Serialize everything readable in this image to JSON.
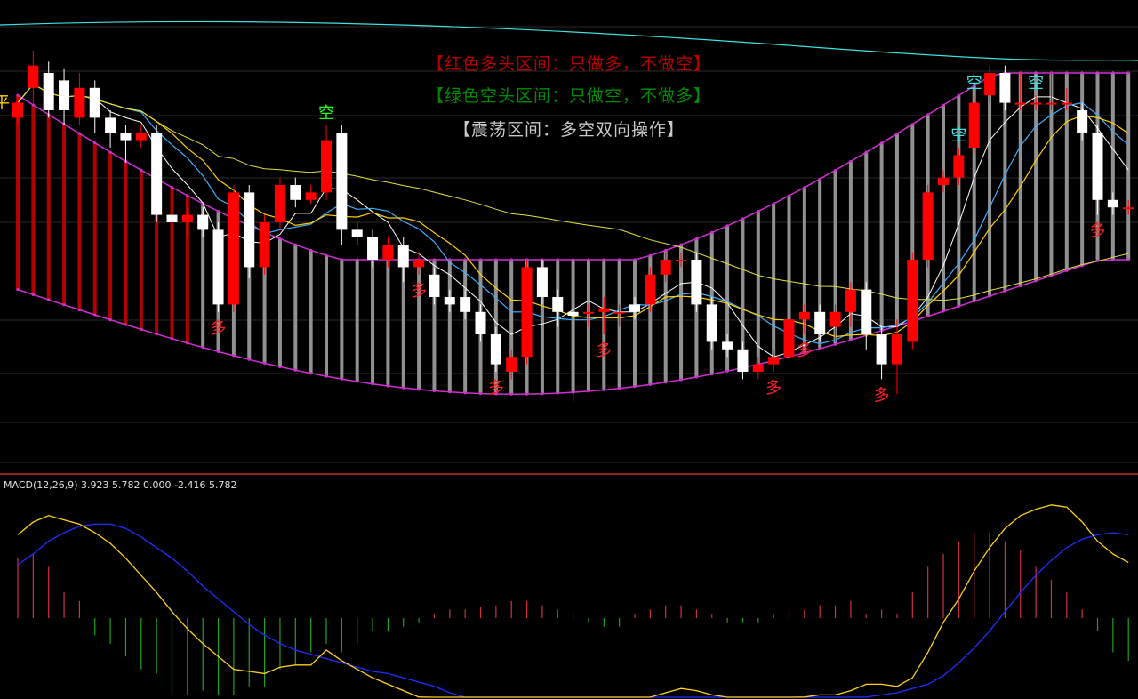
{
  "legend": {
    "red": "【红色多头区间：只做多，不做空】",
    "green": "【绿色空头区间：只做空，不做多】",
    "gray": "【震荡区间：多空双向操作】"
  },
  "macd_label": "MACD(12,26,9) 3.923 5.782 0.000 -2.416 5.782",
  "colors": {
    "bg": "#000000",
    "up": "#ff0000",
    "down": "#ffffff",
    "band": "#d030d0",
    "band_mid": "#e0e040",
    "ma_short": "#ffffff",
    "ma_blue": "#40b0ff",
    "ma_yellow": "#ffd000",
    "top_line": "#40e0e0",
    "bar_red": "#b00000",
    "bar_gray": "#909090",
    "signal_buy": "#ff2020",
    "signal_sell_cyan": "#40e0e0",
    "signal_sell_green": "#20ff20",
    "macd_pos": "#d03040",
    "macd_neg": "#20a020"
  },
  "chart_data": {
    "type": "candlestick",
    "price_ylim": [
      0,
      100
    ],
    "candles": [
      {
        "o": 78,
        "c": 82,
        "h": 84,
        "l": 76
      },
      {
        "o": 86,
        "c": 92,
        "h": 96,
        "l": 82
      },
      {
        "o": 90,
        "c": 80,
        "h": 93,
        "l": 78
      },
      {
        "o": 88,
        "c": 80,
        "h": 91,
        "l": 76
      },
      {
        "o": 78,
        "c": 86,
        "h": 90,
        "l": 76
      },
      {
        "o": 86,
        "c": 78,
        "h": 88,
        "l": 74
      },
      {
        "o": 78,
        "c": 74,
        "h": 80,
        "l": 70
      },
      {
        "o": 74,
        "c": 72,
        "h": 76,
        "l": 66
      },
      {
        "o": 72,
        "c": 74,
        "h": 76,
        "l": 70
      },
      {
        "o": 74,
        "c": 52,
        "h": 76,
        "l": 50
      },
      {
        "o": 52,
        "c": 50,
        "h": 54,
        "l": 48
      },
      {
        "o": 50,
        "c": 52,
        "h": 54,
        "l": 46
      },
      {
        "o": 52,
        "c": 48,
        "h": 54,
        "l": 46
      },
      {
        "o": 48,
        "c": 28,
        "h": 50,
        "l": 26
      },
      {
        "o": 28,
        "c": 58,
        "h": 60,
        "l": 26
      },
      {
        "o": 58,
        "c": 38,
        "h": 60,
        "l": 35
      },
      {
        "o": 38,
        "c": 50,
        "h": 52,
        "l": 36
      },
      {
        "o": 50,
        "c": 60,
        "h": 62,
        "l": 48
      },
      {
        "o": 60,
        "c": 56,
        "h": 62,
        "l": 54
      },
      {
        "o": 56,
        "c": 58,
        "h": 60,
        "l": 55
      },
      {
        "o": 58,
        "c": 72,
        "h": 76,
        "l": 56
      },
      {
        "o": 74,
        "c": 48,
        "h": 76,
        "l": 44
      },
      {
        "o": 48,
        "c": 46,
        "h": 50,
        "l": 44
      },
      {
        "o": 46,
        "c": 40,
        "h": 48,
        "l": 38
      },
      {
        "o": 40,
        "c": 44,
        "h": 46,
        "l": 38
      },
      {
        "o": 44,
        "c": 38,
        "h": 46,
        "l": 34
      },
      {
        "o": 38,
        "c": 40,
        "h": 42,
        "l": 36
      },
      {
        "o": 36,
        "c": 30,
        "h": 38,
        "l": 28
      },
      {
        "o": 30,
        "c": 28,
        "h": 32,
        "l": 26
      },
      {
        "o": 30,
        "c": 26,
        "h": 32,
        "l": 24
      },
      {
        "o": 26,
        "c": 20,
        "h": 28,
        "l": 18
      },
      {
        "o": 20,
        "c": 12,
        "h": 22,
        "l": 10
      },
      {
        "o": 10,
        "c": 14,
        "h": 16,
        "l": 8
      },
      {
        "o": 14,
        "c": 38,
        "h": 40,
        "l": 12
      },
      {
        "o": 38,
        "c": 30,
        "h": 40,
        "l": 28
      },
      {
        "o": 30,
        "c": 26,
        "h": 32,
        "l": 22
      },
      {
        "o": 26,
        "c": 25,
        "h": 28,
        "l": 2
      },
      {
        "o": 26,
        "c": 26,
        "h": 28,
        "l": 22
      },
      {
        "o": 26,
        "c": 27,
        "h": 30,
        "l": 20
      },
      {
        "o": 26,
        "c": 26,
        "h": 28,
        "l": 22
      },
      {
        "o": 28,
        "c": 26,
        "h": 30,
        "l": 24
      },
      {
        "o": 28,
        "c": 36,
        "h": 38,
        "l": 26
      },
      {
        "o": 36,
        "c": 40,
        "h": 42,
        "l": 34
      },
      {
        "o": 40,
        "c": 40,
        "h": 42,
        "l": 38
      },
      {
        "o": 40,
        "c": 28,
        "h": 42,
        "l": 26
      },
      {
        "o": 28,
        "c": 18,
        "h": 30,
        "l": 16
      },
      {
        "o": 18,
        "c": 16,
        "h": 20,
        "l": 14
      },
      {
        "o": 16,
        "c": 10,
        "h": 18,
        "l": 8
      },
      {
        "o": 10,
        "c": 12,
        "h": 14,
        "l": 8
      },
      {
        "o": 12,
        "c": 14,
        "h": 16,
        "l": 10
      },
      {
        "o": 14,
        "c": 24,
        "h": 26,
        "l": 12
      },
      {
        "o": 24,
        "c": 26,
        "h": 28,
        "l": 20
      },
      {
        "o": 26,
        "c": 20,
        "h": 28,
        "l": 18
      },
      {
        "o": 22,
        "c": 26,
        "h": 28,
        "l": 18
      },
      {
        "o": 26,
        "c": 32,
        "h": 34,
        "l": 22
      },
      {
        "o": 32,
        "c": 20,
        "h": 34,
        "l": 16
      },
      {
        "o": 20,
        "c": 12,
        "h": 22,
        "l": 8
      },
      {
        "o": 12,
        "c": 20,
        "h": 24,
        "l": 4
      },
      {
        "o": 18,
        "c": 40,
        "h": 42,
        "l": 16
      },
      {
        "o": 40,
        "c": 58,
        "h": 60,
        "l": 38
      },
      {
        "o": 60,
        "c": 62,
        "h": 64,
        "l": 58
      },
      {
        "o": 62,
        "c": 68,
        "h": 70,
        "l": 60
      },
      {
        "o": 70,
        "c": 82,
        "h": 84,
        "l": 68
      },
      {
        "o": 84,
        "c": 90,
        "h": 92,
        "l": 82
      },
      {
        "o": 90,
        "c": 82,
        "h": 92,
        "l": 80
      },
      {
        "o": 82,
        "c": 82,
        "h": 90,
        "l": 80
      },
      {
        "o": 82,
        "c": 82,
        "h": 84,
        "l": 80
      },
      {
        "o": 82,
        "c": 82,
        "h": 90,
        "l": 80
      },
      {
        "o": 82,
        "c": 82,
        "h": 86,
        "l": 80
      },
      {
        "o": 80,
        "c": 74,
        "h": 82,
        "l": 72
      },
      {
        "o": 74,
        "c": 56,
        "h": 76,
        "l": 52
      },
      {
        "o": 56,
        "c": 54,
        "h": 58,
        "l": 52
      },
      {
        "o": 54,
        "c": 54,
        "h": 56,
        "l": 52
      }
    ],
    "signals": [
      {
        "i": 0,
        "label": "平",
        "pos": "left"
      },
      {
        "i": 13,
        "label": "多",
        "pos": "below"
      },
      {
        "i": 20,
        "label": "空",
        "pos": "above"
      },
      {
        "i": 26,
        "label": "多",
        "pos": "below"
      },
      {
        "i": 31,
        "label": "多",
        "pos": "below"
      },
      {
        "i": 38,
        "label": "多",
        "pos": "below"
      },
      {
        "i": 49,
        "label": "多",
        "pos": "below"
      },
      {
        "i": 51,
        "label": "多",
        "pos": "below"
      },
      {
        "i": 56,
        "label": "多",
        "pos": "below"
      },
      {
        "i": 61,
        "label": "空",
        "pos": "above"
      },
      {
        "i": 62,
        "label": "空",
        "pos": "above"
      },
      {
        "i": 66,
        "label": "空",
        "pos": "above"
      },
      {
        "i": 70,
        "label": "多",
        "pos": "below"
      }
    ],
    "macd": {
      "params": "12,26,9",
      "dif": [
        3.9,
        4.5,
        4.8,
        4.6,
        4.4,
        4.0,
        3.5,
        2.8,
        2.0,
        1.2,
        0.3,
        -0.5,
        -1.2,
        -1.8,
        -2.4,
        -2.5,
        -2.6,
        -2.3,
        -2.2,
        -2.2,
        -1.5,
        -2.0,
        -2.4,
        -2.8,
        -3.1,
        -3.4,
        -3.7,
        -4.0,
        -4.3,
        -4.6,
        -4.9,
        -5.1,
        -5.3,
        -4.9,
        -4.6,
        -4.5,
        -4.5,
        -4.4,
        -4.3,
        -4.2,
        -4.1,
        -3.8,
        -3.5,
        -3.3,
        -3.4,
        -3.6,
        -3.9,
        -4.0,
        -4.1,
        -4.0,
        -3.8,
        -3.7,
        -3.6,
        -3.6,
        -3.4,
        -3.1,
        -3.1,
        -3.2,
        -2.8,
        -1.6,
        -0.2,
        0.9,
        2.2,
        3.3,
        4.2,
        4.8,
        5.1,
        5.3,
        5.2,
        4.5,
        3.6,
        3.0,
        2.6
      ],
      "dea": [
        2.5,
        3.0,
        3.6,
        4.0,
        4.3,
        4.4,
        4.4,
        4.2,
        3.8,
        3.3,
        2.8,
        2.2,
        1.5,
        0.9,
        0.3,
        -0.3,
        -0.8,
        -1.2,
        -1.5,
        -1.7,
        -1.9,
        -2.1,
        -2.3,
        -2.5,
        -2.6,
        -2.8,
        -3.0,
        -3.2,
        -3.5,
        -3.8,
        -4.1,
        -4.3,
        -4.5,
        -4.7,
        -4.7,
        -4.7,
        -4.6,
        -4.5,
        -4.5,
        -4.4,
        -4.3,
        -4.2,
        -4.1,
        -4.0,
        -3.9,
        -3.9,
        -3.9,
        -3.9,
        -3.9,
        -3.9,
        -3.9,
        -3.9,
        -3.9,
        -3.9,
        -3.8,
        -3.7,
        -3.6,
        -3.5,
        -3.3,
        -3.1,
        -2.7,
        -2.1,
        -1.4,
        -0.6,
        0.3,
        1.2,
        2.0,
        2.7,
        3.3,
        3.7,
        3.9,
        4.0,
        3.9
      ],
      "hist": [
        2.8,
        3.0,
        2.4,
        1.2,
        0.8,
        -0.8,
        -1.2,
        -1.8,
        -2.4,
        -2.6,
        -3.6,
        -3.6,
        -3.4,
        -3.6,
        -3.6,
        -3.2,
        -3.2,
        -2.4,
        -2.2,
        -1.6,
        -1.2,
        -1.6,
        -1.2,
        -0.6,
        -0.6,
        -0.4,
        -0.2,
        0.2,
        0.4,
        0.4,
        0.5,
        0.6,
        0.8,
        0.8,
        0.6,
        0.4,
        0.2,
        -0.2,
        -0.4,
        -0.4,
        0.2,
        0.4,
        0.6,
        0.6,
        0.4,
        0.2,
        -0.2,
        -0.2,
        -0.2,
        0.2,
        0.4,
        0.4,
        0.6,
        0.6,
        0.8,
        0.2,
        0.4,
        0.2,
        1.2,
        2.4,
        3.0,
        3.6,
        4.0,
        4.0,
        3.6,
        3.2,
        2.4,
        1.8,
        1.2,
        0.4,
        -0.6,
        -1.6,
        -2.0
      ]
    }
  }
}
